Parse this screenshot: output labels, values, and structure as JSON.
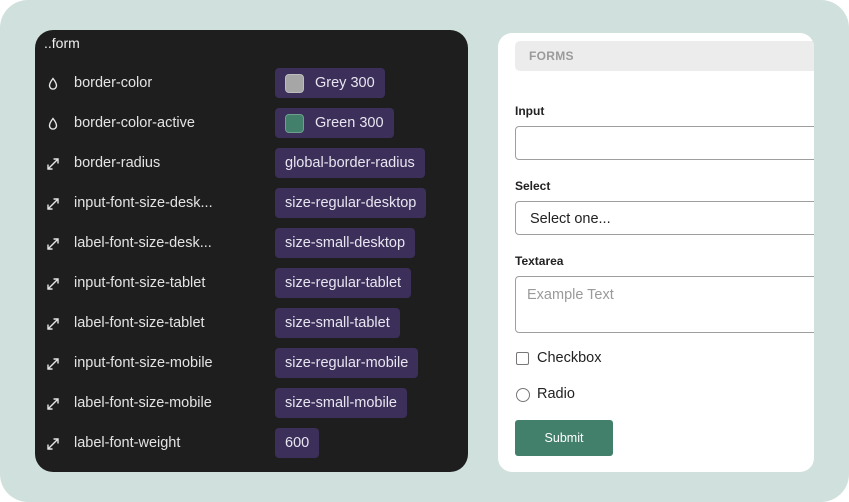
{
  "tokens_panel": {
    "title": "..form",
    "rows": [
      {
        "icon": "drop-icon",
        "name": "border-color",
        "value": "Grey 300",
        "swatch": "#a6a6a6"
      },
      {
        "icon": "drop-icon",
        "name": "border-color-active",
        "value": "Green 300",
        "swatch": "#43806c"
      },
      {
        "icon": "resize-arrow-icon",
        "name": "border-radius",
        "value": "global-border-radius"
      },
      {
        "icon": "resize-arrow-icon",
        "name": "input-font-size-desk...",
        "value": "size-regular-desktop"
      },
      {
        "icon": "resize-arrow-icon",
        "name": "label-font-size-desk...",
        "value": "size-small-desktop"
      },
      {
        "icon": "resize-arrow-icon",
        "name": "input-font-size-tablet",
        "value": "size-regular-tablet"
      },
      {
        "icon": "resize-arrow-icon",
        "name": "label-font-size-tablet",
        "value": "size-small-tablet"
      },
      {
        "icon": "resize-arrow-icon",
        "name": "input-font-size-mobile",
        "value": "size-regular-mobile"
      },
      {
        "icon": "resize-arrow-icon",
        "name": "label-font-size-mobile",
        "value": "size-small-mobile"
      },
      {
        "icon": "resize-arrow-icon",
        "name": "label-font-weight",
        "value": "600"
      }
    ]
  },
  "preview": {
    "header": "FORMS",
    "input_label": "Input",
    "input_value": "",
    "select_label": "Select",
    "select_value": "Select one...",
    "textarea_label": "Textarea",
    "textarea_placeholder": "Example Text",
    "checkbox_label": "Checkbox",
    "radio_label": "Radio",
    "submit_label": "Submit"
  },
  "colors": {
    "background": "#d0e0dc",
    "panel_dark": "#1e1e1e",
    "chip": "#3c2f5a",
    "accent_green": "#43806c"
  }
}
